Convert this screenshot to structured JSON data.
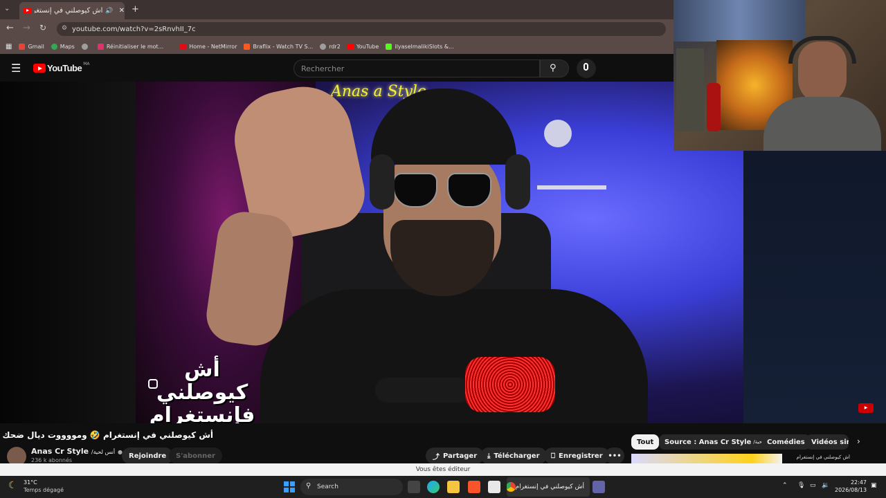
{
  "browser": {
    "tab_title": "أش كيوصلني في إنستغرام",
    "url": "youtube.com/watch?v=2sRnvhII_7c",
    "bookmarks": [
      {
        "label": "Gmail",
        "color": "#ea4335"
      },
      {
        "label": "Maps",
        "color": "#34a853"
      },
      {
        "label": "",
        "color": "#9e9e9e"
      },
      {
        "label": "Réinitialiser le mot...",
        "color": "#e1306c"
      },
      {
        "label": "Home - NetMirror",
        "color": "#e50914"
      },
      {
        "label": "Braflix - Watch TV S...",
        "color": "#ff5722"
      },
      {
        "label": "rdr2",
        "color": "#9e9e9e"
      },
      {
        "label": "YouTube",
        "color": "#ff0000"
      },
      {
        "label": "ilyaselmalikiSlots &...",
        "color": "#53fc18"
      }
    ]
  },
  "youtube": {
    "logo_text": "YouTube",
    "region": "MA",
    "search_placeholder": "Rechercher",
    "video_overlay_text": "أش كيوصلني فإنستغرام",
    "neon_sign": "Anas a Style",
    "video_title": "أش كيوصلني في إنستغرام 🤣 ومووووت ديال ضحك 🤣🤣 #58",
    "channel_name": "Anas Cr Style",
    "channel_alias": "/أنس لحية",
    "subscribers": "236 k abonnés",
    "join_label": "Rejoindre",
    "subscribe_label": "S'abonner",
    "share_label": "Partager",
    "download_label": "Télécharger",
    "save_label": "Enregistrer",
    "chips": [
      "Tout",
      "Source : Anas Cr Style",
      "Comédies",
      "Vidéos simi"
    ],
    "chip_source_alias": "/أنس لحية",
    "editor_notice": "Vous êtes éditeur"
  },
  "taskbar": {
    "weather_temp": "31°C",
    "weather_desc": "Temps dégagé",
    "search_label": "Search",
    "active_app": "أش كيوصلني في إنستغرام",
    "time": "22:47",
    "date": "2026/08/13"
  }
}
